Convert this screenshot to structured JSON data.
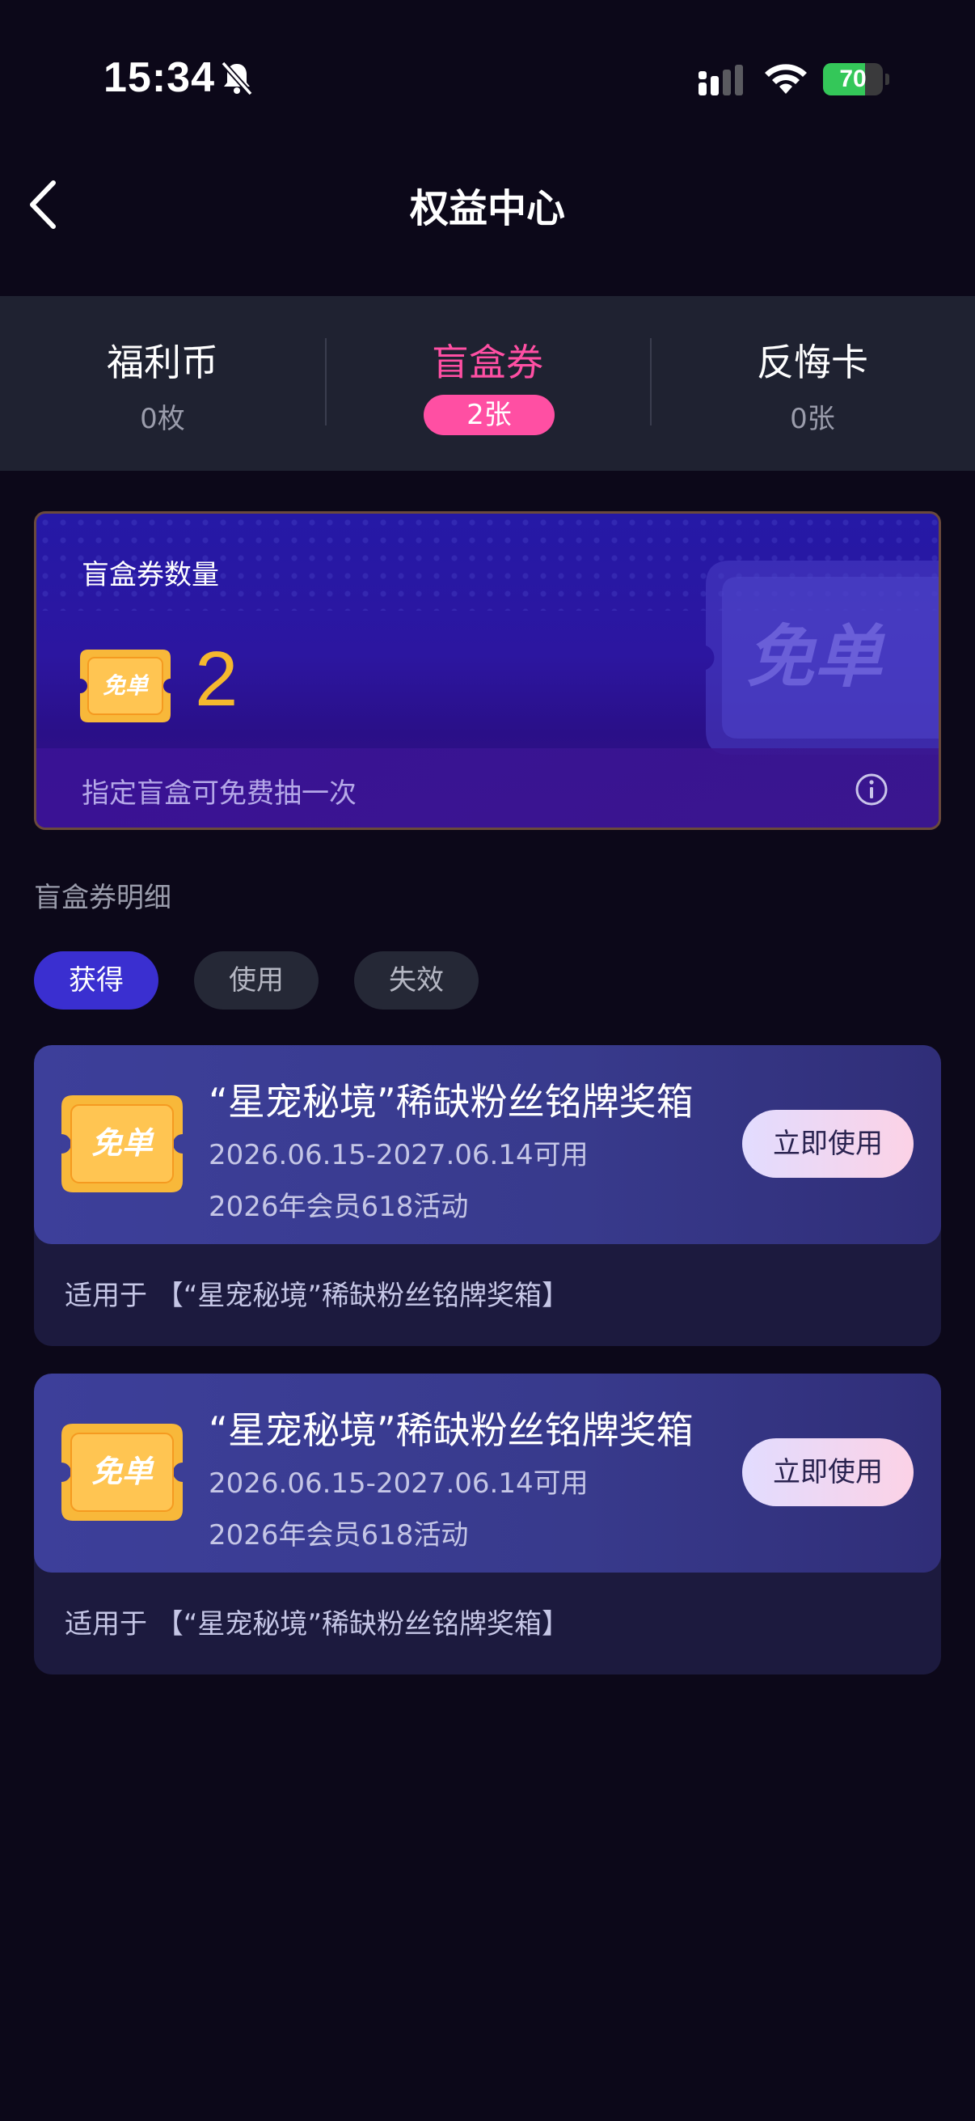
{
  "status_bar": {
    "time": "15:34",
    "battery": "70",
    "battery_level": 0.7
  },
  "nav": {
    "title": "权益中心"
  },
  "summary": [
    {
      "label": "福利币",
      "count": "0枚"
    },
    {
      "label": "盲盒券",
      "count": "2张"
    },
    {
      "label": "反悔卡",
      "count": "0张"
    }
  ],
  "hero": {
    "title": "盲盒券数量",
    "badge_text": "免单",
    "count": "2",
    "bg_ticket_text": "免单",
    "footer": "指定盲盒可免费抽一次"
  },
  "details": {
    "title": "盲盒券明细",
    "filters": [
      "获得",
      "使用",
      "失效"
    ],
    "coupons": [
      {
        "badge": "免单",
        "title": "“星宠秘境”稀缺粉丝铭牌奖箱",
        "valid": "2026.06.15-2027.06.14可用",
        "activity": "2026年会员618活动",
        "button": "立即使用",
        "applies": "适用于 【“星宠秘境”稀缺粉丝铭牌奖箱】"
      },
      {
        "badge": "免单",
        "title": "“星宠秘境”稀缺粉丝铭牌奖箱",
        "valid": "2026.06.15-2027.06.14可用",
        "activity": "2026年会员618活动",
        "button": "立即使用",
        "applies": "适用于 【“星宠秘境”稀缺粉丝铭牌奖箱】"
      }
    ]
  },
  "colors": {
    "background": "#0c0819",
    "accent_pink": "#ff4fa3",
    "accent_gold": "#f5b82e",
    "active_filter": "#3a2fd0"
  }
}
